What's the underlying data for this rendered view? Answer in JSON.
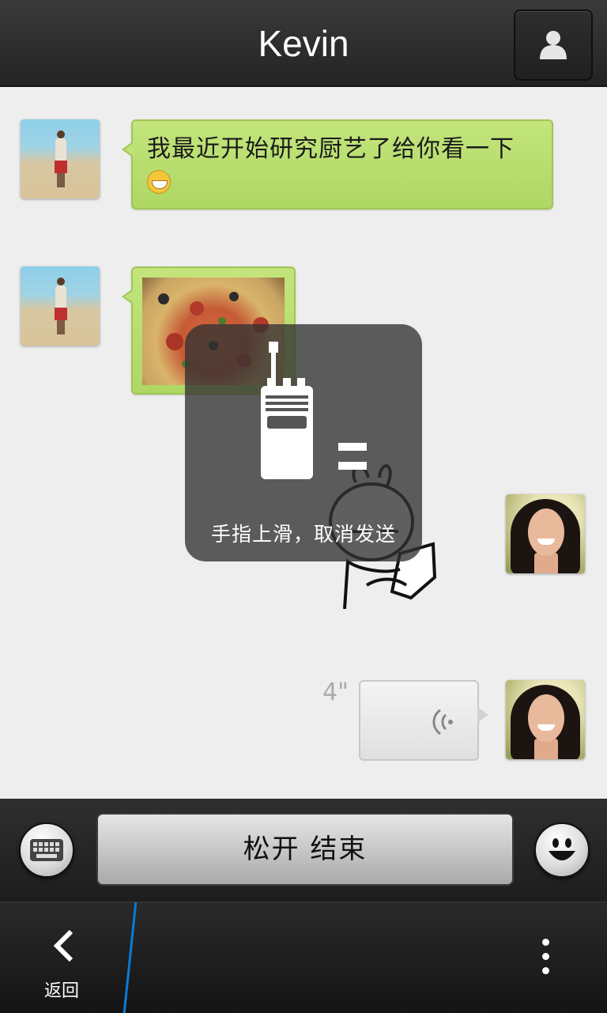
{
  "header": {
    "title": "Kevin",
    "contact_icon": "person-icon"
  },
  "messages": [
    {
      "sender": "Kevin",
      "type": "text",
      "text": "我最近开始研究厨艺了给你看一下",
      "emoji": "grin-emoji"
    },
    {
      "sender": "Kevin",
      "type": "image",
      "image": "pizza"
    },
    {
      "sender": "me",
      "type": "sticker",
      "sticker": "rabbit-sticker"
    },
    {
      "sender": "me",
      "type": "voice",
      "duration": "4\""
    }
  ],
  "overlay": {
    "hint": "手指上滑，取消发送",
    "icon": "walkie-talkie-icon"
  },
  "inputbar": {
    "talk_label": "松开 结束",
    "keyboard_icon": "keyboard-icon",
    "emoji_icon": "smiley-icon"
  },
  "nav": {
    "back_label": "返回",
    "more_icon": "more-vertical-icon"
  },
  "colors": {
    "accent": "#0b7cd6",
    "bubble_green": "#b7de6e"
  }
}
